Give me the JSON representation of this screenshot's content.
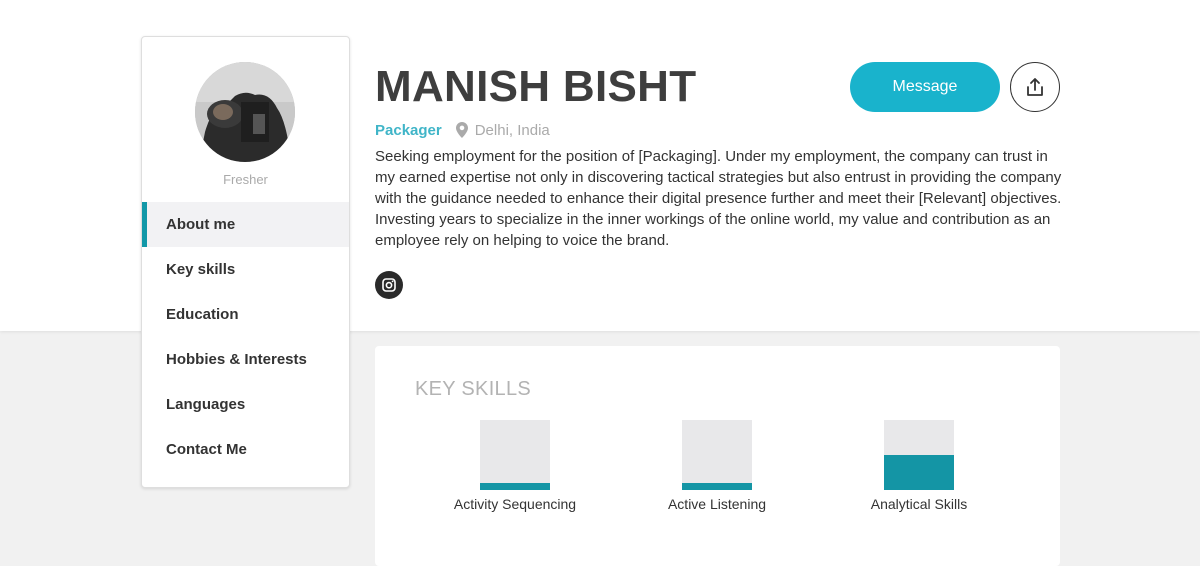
{
  "profile": {
    "name": "MANISH BISHT",
    "role": "Packager",
    "location": "Delhi, India",
    "experience_label": "Fresher",
    "summary": "Seeking employment for the position of [Packaging]. Under my employment, the company can trust in my earned expertise not only in discovering tactical strategies but also entrust in providing the company with the guidance needed to enhance their digital presence further and meet their [Relevant] objectives. Investing years to specialize in the inner workings of the online world, my value and contribution as an employee rely on helping to voice the brand."
  },
  "actions": {
    "message_label": "Message",
    "share_icon": "share-icon"
  },
  "social": {
    "instagram_icon": "instagram-icon"
  },
  "sidebar": {
    "items": [
      {
        "label": "About me",
        "active": true
      },
      {
        "label": "Key skills"
      },
      {
        "label": "Education"
      },
      {
        "label": "Hobbies & Interests"
      },
      {
        "label": "Languages"
      },
      {
        "label": "Contact Me"
      }
    ]
  },
  "key_skills": {
    "title": "KEY SKILLS",
    "items": [
      {
        "label": "Activity Sequencing",
        "level": 0.1
      },
      {
        "label": "Active Listening",
        "level": 0.1
      },
      {
        "label": "Analytical Skills",
        "level": 0.5
      }
    ]
  },
  "colors": {
    "accent": "#19b3cc",
    "accent_dark": "#1495a5",
    "role_text": "#40b5c8"
  }
}
